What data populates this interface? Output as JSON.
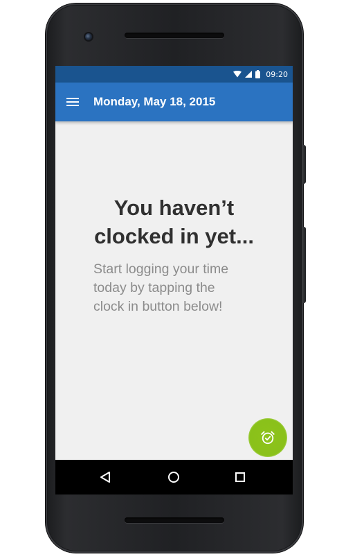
{
  "status_bar": {
    "time": "09:20",
    "icons": [
      "wifi-icon",
      "signal-icon",
      "battery-icon"
    ]
  },
  "app_bar": {
    "menu_icon": "hamburger-menu-icon",
    "title": "Monday, May 18, 2015"
  },
  "empty_state": {
    "headline_line1": "You haven’t",
    "headline_line2": "clocked in yet...",
    "message_line1": "Start logging your time",
    "message_line2": "today by tapping the",
    "message_line3": "clock in button below!"
  },
  "fab": {
    "icon": "alarm-clock-icon"
  },
  "nav_bar": {
    "icons": [
      "back-triangle-icon",
      "home-circle-icon",
      "recents-square-icon"
    ]
  },
  "colors": {
    "status_bar": "#1a548f",
    "app_bar": "#2b73c1",
    "background": "#f0f0f0",
    "headline_text": "#303030",
    "message_text": "#8c8c8c",
    "fab": "#8ac11a"
  }
}
